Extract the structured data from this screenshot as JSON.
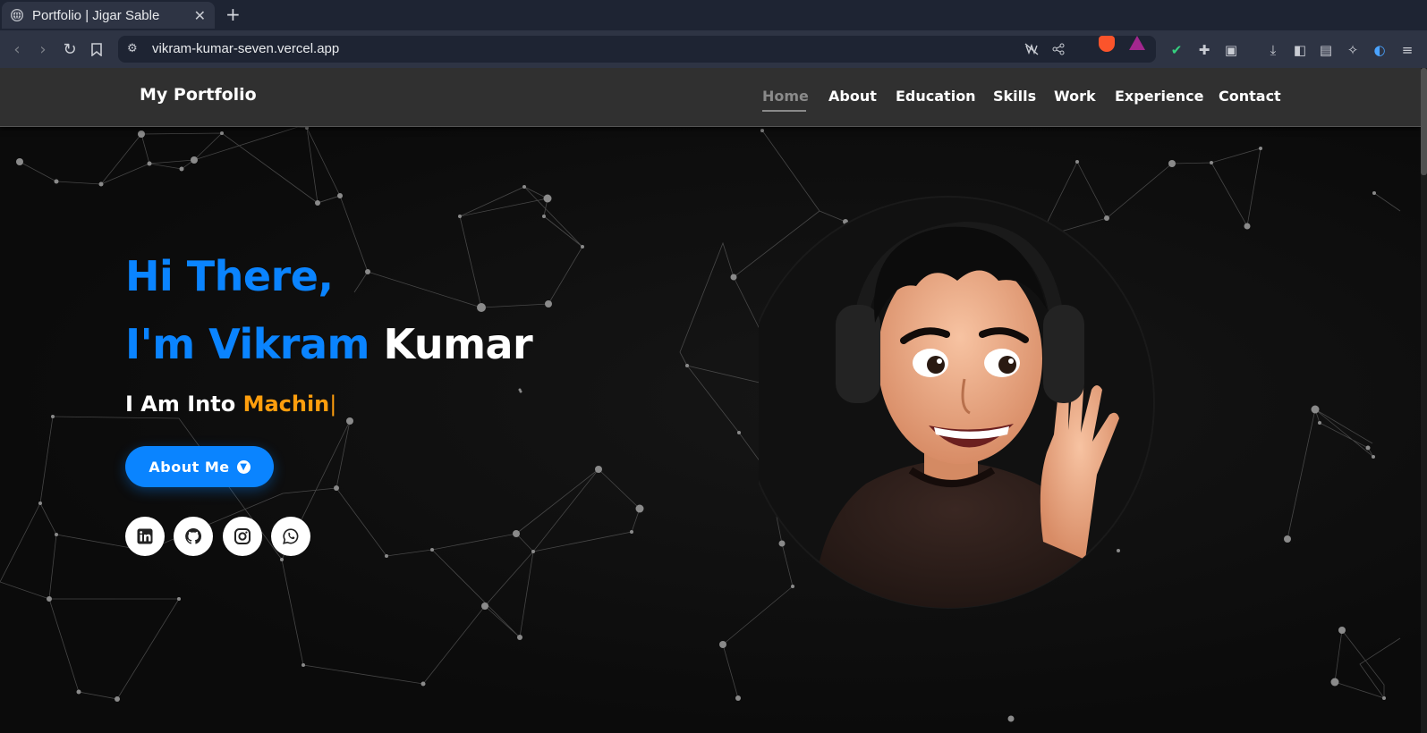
{
  "browser": {
    "tab_title": "Portfolio | Jigar Sable",
    "tab_close": "✕",
    "new_tab": "+",
    "url": "vikram-kumar-seven.vercel.app"
  },
  "site": {
    "logo": "My Portfolio",
    "nav": [
      {
        "label": "Home",
        "active": true
      },
      {
        "label": "About"
      },
      {
        "label": "Education"
      },
      {
        "label": "Skills"
      },
      {
        "label": "Work"
      },
      {
        "label": "Experience"
      },
      {
        "label": "Contact"
      }
    ]
  },
  "hero": {
    "greeting": "Hi There,",
    "intro_prefix": "I'm Vikram",
    "intro_last": "Kumar",
    "sub_prefix": "I Am Into",
    "typed_text": "Machin",
    "cursor": "|",
    "button_label": "About Me",
    "socials": [
      "linkedin-icon",
      "github-icon",
      "instagram-icon",
      "whatsapp-icon"
    ]
  },
  "colors": {
    "accent_blue": "#0a84ff",
    "accent_orange": "#ff9e0d",
    "header_bg": "#303030",
    "page_bg": "#0d0d0d"
  }
}
